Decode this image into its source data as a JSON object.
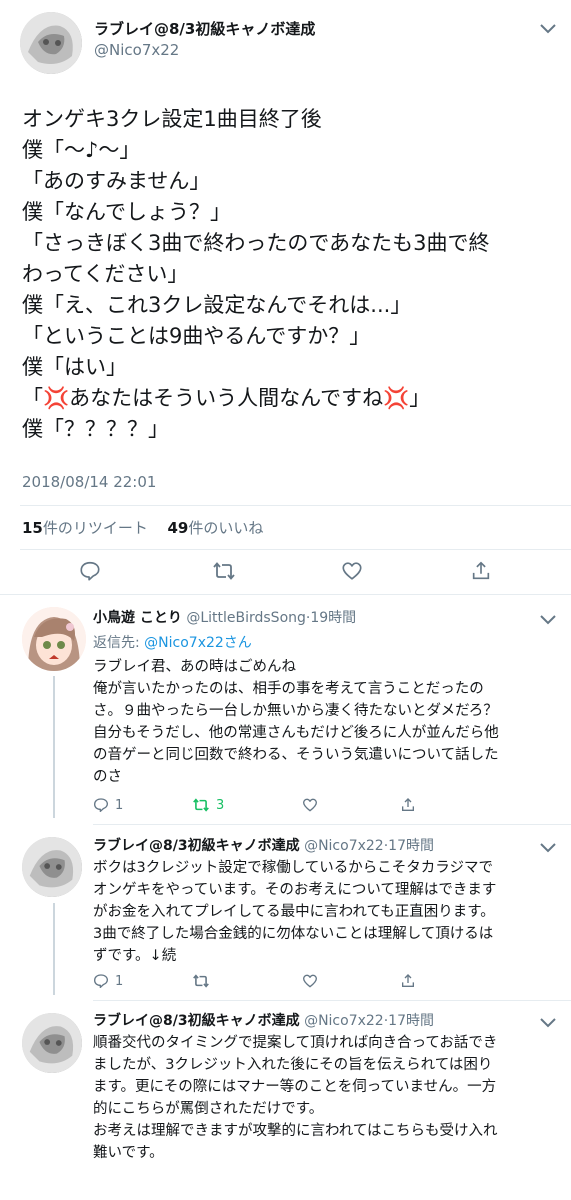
{
  "main_tweet": {
    "display_name": "ラブレイ@8/3初級キャノボ達成",
    "handle": "@Nico7x22",
    "lines": [
      "オンゲキ3クレ設定1曲目終了後",
      "僕「〜♪〜」",
      "「あのすみません」",
      "僕「なんでしょう？」",
      "「さっきぼく3曲で終わったのであなたも3曲で終",
      "わってください」",
      "僕「え、これ3クレ設定なんでそれは...」",
      "「ということは9曲やるんですか？」",
      "僕「はい」",
      "「💢あなたはそういう人間なんですね💢」",
      "僕「？？？？」"
    ],
    "timestamp": "2018/08/14 22:01",
    "retweet_count": "15",
    "retweet_label": "件のリツイート",
    "like_count": "49",
    "like_label": "件のいいね"
  },
  "replies": [
    {
      "display_name": "小鳥遊 ことり",
      "handle": "@LittleBirdsSong",
      "time": "19時間",
      "reply_to_label": "返信先:",
      "reply_to": "@Nico7x22さん",
      "lines": [
        "ラブレイ君、あの時はごめんね",
        "俺が言いたかったのは、相手の事を考えて言うことだったの",
        "さ。９曲やったら一台しか無いから凄く待たないとダメだろ？",
        "自分もそうだし、他の常連さんもだけど後ろに人が並んだら他",
        "の音ゲーと同じ回数で終わる、そういう気遣いについて話した",
        "のさ"
      ],
      "reply_count": "1",
      "retweet_count": "3"
    },
    {
      "display_name": "ラブレイ@8/3初級キャノボ達成",
      "handle": "@Nico7x22",
      "time": "17時間",
      "lines": [
        "ボクは3クレジット設定で稼働しているからこそタカラジマで",
        "オンゲキをやっています。そのお考えについて理解はできます",
        "がお金を入れてプレイしてる最中に言われても正直困ります。",
        "3曲で終了した場合金銭的に勿体ないことは理解して頂けるは",
        "ずです。↓続"
      ],
      "reply_count": "1"
    },
    {
      "display_name": "ラブレイ@8/3初級キャノボ達成",
      "handle": "@Nico7x22",
      "time": "17時間",
      "lines": [
        "順番交代のタイミングで提案して頂ければ向き合ってお話でき",
        "ましたが、3クレジット入れた後にその旨を伝えられては困り",
        "ます。更にその際にはマナー等のことを伺っていません。一方",
        "的にこちらが罵倒されただけです。",
        "お考えは理解できますが攻撃的に言われてはこちらも受け入れ",
        "難いです。"
      ]
    }
  ],
  "icons": [
    "reply-icon",
    "retweet-icon",
    "like-icon",
    "share-icon",
    "chevron-down-icon"
  ],
  "colors": {
    "link": "#1b95e0",
    "muted": "#657786",
    "retweet_active": "#17bf63",
    "divider": "#e6ecf0"
  }
}
